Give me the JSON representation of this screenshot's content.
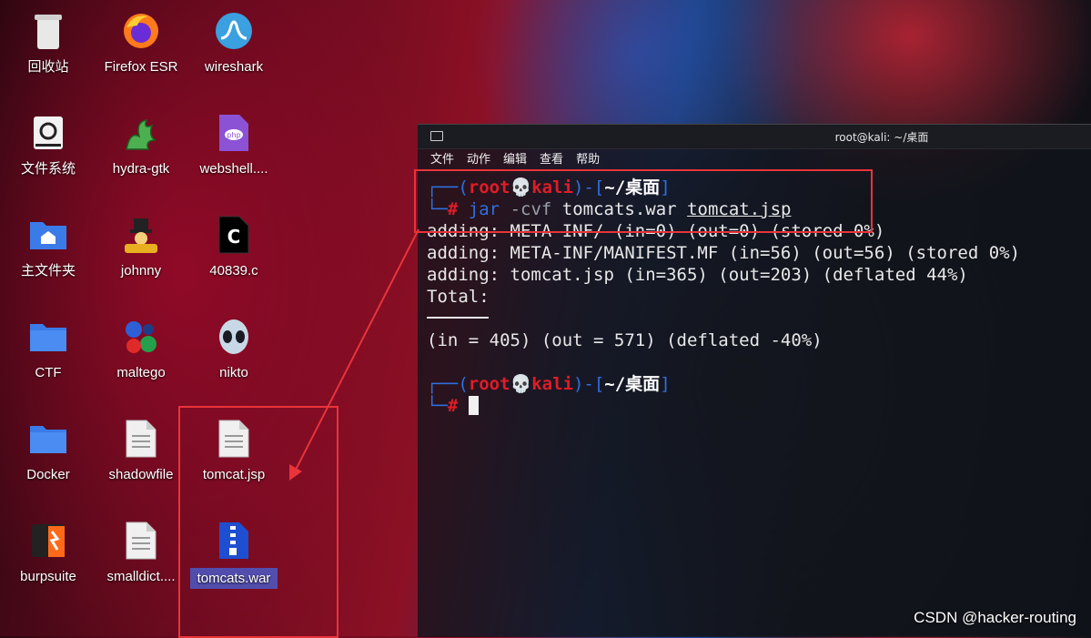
{
  "desktop": {
    "icons": [
      {
        "label": "回收站",
        "icon": "trash-icon"
      },
      {
        "label": "Firefox ESR",
        "icon": "firefox-icon"
      },
      {
        "label": "wireshark",
        "icon": "wireshark-icon"
      },
      {
        "label": "文件系统",
        "icon": "drive-icon"
      },
      {
        "label": "hydra-gtk",
        "icon": "hydra-icon"
      },
      {
        "label": "webshell....",
        "icon": "php-file-icon"
      },
      {
        "label": "主文件夹",
        "icon": "home-folder-icon"
      },
      {
        "label": "johnny",
        "icon": "johnny-icon"
      },
      {
        "label": "40839.c",
        "icon": "c-file-icon"
      },
      {
        "label": "CTF",
        "icon": "folder-icon"
      },
      {
        "label": "maltego",
        "icon": "maltego-icon"
      },
      {
        "label": "nikto",
        "icon": "nikto-icon"
      },
      {
        "label": "Docker",
        "icon": "folder-icon"
      },
      {
        "label": "shadowfile",
        "icon": "text-file-icon"
      },
      {
        "label": "tomcat.jsp",
        "icon": "text-file-icon"
      },
      {
        "label": "burpsuite",
        "icon": "burpsuite-icon"
      },
      {
        "label": "smalldict....",
        "icon": "text-file-icon"
      },
      {
        "label": "tomcats.war",
        "icon": "archive-icon"
      }
    ]
  },
  "terminal": {
    "title": "root@kali: ~/桌面",
    "menu": [
      "文件",
      "动作",
      "编辑",
      "查看",
      "帮助"
    ],
    "prompt": {
      "open": "┌──(",
      "user": "root",
      "skull": "💀",
      "host": "kali",
      "mid": ")-[",
      "path": "~/桌面",
      "close": "]",
      "second": "└─",
      "hash": "#"
    },
    "command": {
      "program": "jar",
      "flags": "-cvf",
      "arg1": "tomcats.war",
      "arg2": "tomcat.jsp"
    },
    "output": [
      "adding: META-INF/ (in=0) (out=0) (stored 0%)",
      "adding: META-INF/MANIFEST.MF (in=56) (out=56) (stored 0%)",
      "adding: tomcat.jsp (in=365) (out=203) (deflated 44%)",
      "Total:"
    ],
    "total_line": "(in = 405) (out = 571) (deflated -40%)"
  },
  "watermark": "CSDN @hacker-routing",
  "colors": {
    "annotation": "#e8343a",
    "prompt_blue": "#2f6fe0",
    "prompt_red": "#e01c28"
  }
}
